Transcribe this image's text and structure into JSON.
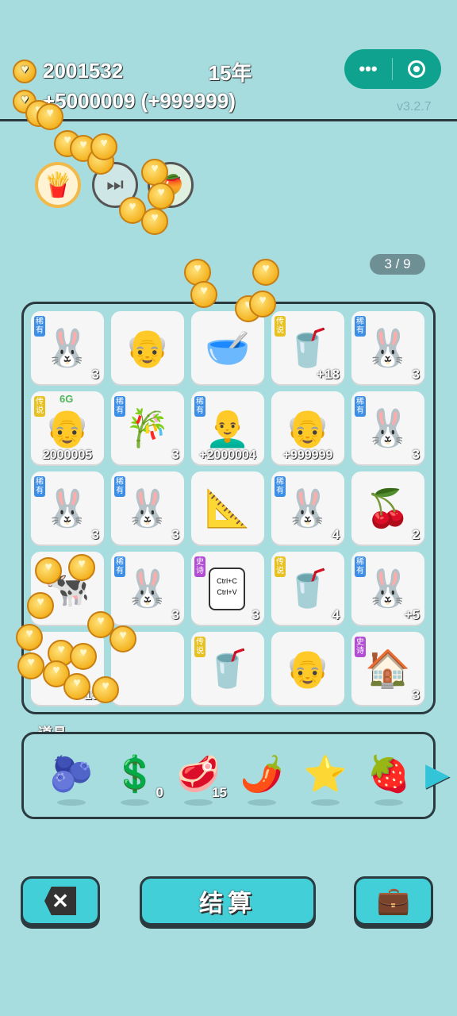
{
  "header": {
    "coins": "2001532",
    "income": "+5000009 (+999999)",
    "year": "15年",
    "more_icon": "•••",
    "version": "v3.2.7"
  },
  "skills": [
    "french-fries",
    "skip-forward",
    "leaf-fruit"
  ],
  "page_indicator": "3 / 9",
  "board": {
    "cells": [
      {
        "tag": "稀有",
        "icon": "🐰",
        "count": "3"
      },
      {
        "tag": "",
        "icon": "👴",
        "count": ""
      },
      {
        "tag": "",
        "icon": "🥣",
        "count": ""
      },
      {
        "tag": "传说",
        "icon": "🥤",
        "count": "+18"
      },
      {
        "tag": "稀有",
        "icon": "🐰",
        "count": "3"
      },
      {
        "tag": "传说",
        "icon": "👴",
        "count": "2000005",
        "label": "6G"
      },
      {
        "tag": "稀有",
        "icon": "🎋",
        "count": "3"
      },
      {
        "tag": "稀有",
        "icon": "👨‍🦲",
        "count": "+2000004"
      },
      {
        "tag": "",
        "icon": "👴",
        "count": "+999999"
      },
      {
        "tag": "稀有",
        "icon": "🐰",
        "count": "3"
      },
      {
        "tag": "稀有",
        "icon": "🐰",
        "count": "3"
      },
      {
        "tag": "稀有",
        "icon": "🐰",
        "count": "3"
      },
      {
        "tag": "",
        "icon": "📐",
        "count": ""
      },
      {
        "tag": "稀有",
        "icon": "🐰",
        "count": "4"
      },
      {
        "tag": "",
        "icon": "🍒",
        "count": "2"
      },
      {
        "tag": "",
        "icon": "🐄",
        "count": ""
      },
      {
        "tag": "稀有",
        "icon": "🐰",
        "count": "3"
      },
      {
        "tag": "史诗",
        "icon": "ctrl",
        "count": "3",
        "ctrl": "Ctrl+C\nCtrl+V"
      },
      {
        "tag": "传说",
        "icon": "🥤",
        "count": "4"
      },
      {
        "tag": "稀有",
        "icon": "🐰",
        "count": "+5"
      },
      {
        "tag": "",
        "icon": "",
        "count": "15"
      },
      {
        "tag": "",
        "icon": "",
        "count": ""
      },
      {
        "tag": "传说",
        "icon": "🥤",
        "count": ""
      },
      {
        "tag": "",
        "icon": "👴",
        "count": ""
      },
      {
        "tag": "史诗",
        "icon": "🏠",
        "count": "3"
      }
    ]
  },
  "items": {
    "title": "道具",
    "list": [
      {
        "icon": "🫐",
        "count": ""
      },
      {
        "icon": "💲",
        "count": "0"
      },
      {
        "icon": "🥩",
        "count": "15"
      },
      {
        "icon": "🌶️",
        "count": ""
      },
      {
        "icon": "⭐",
        "count": ""
      },
      {
        "icon": "🍓",
        "count": ""
      }
    ],
    "next_arrow": "▶"
  },
  "buttons": {
    "close": "✕",
    "settle": "结算",
    "bag": "💼"
  },
  "colors": {
    "background": "#a8dde0",
    "accent": "#43cfd8",
    "capsule": "#0fa38f"
  }
}
